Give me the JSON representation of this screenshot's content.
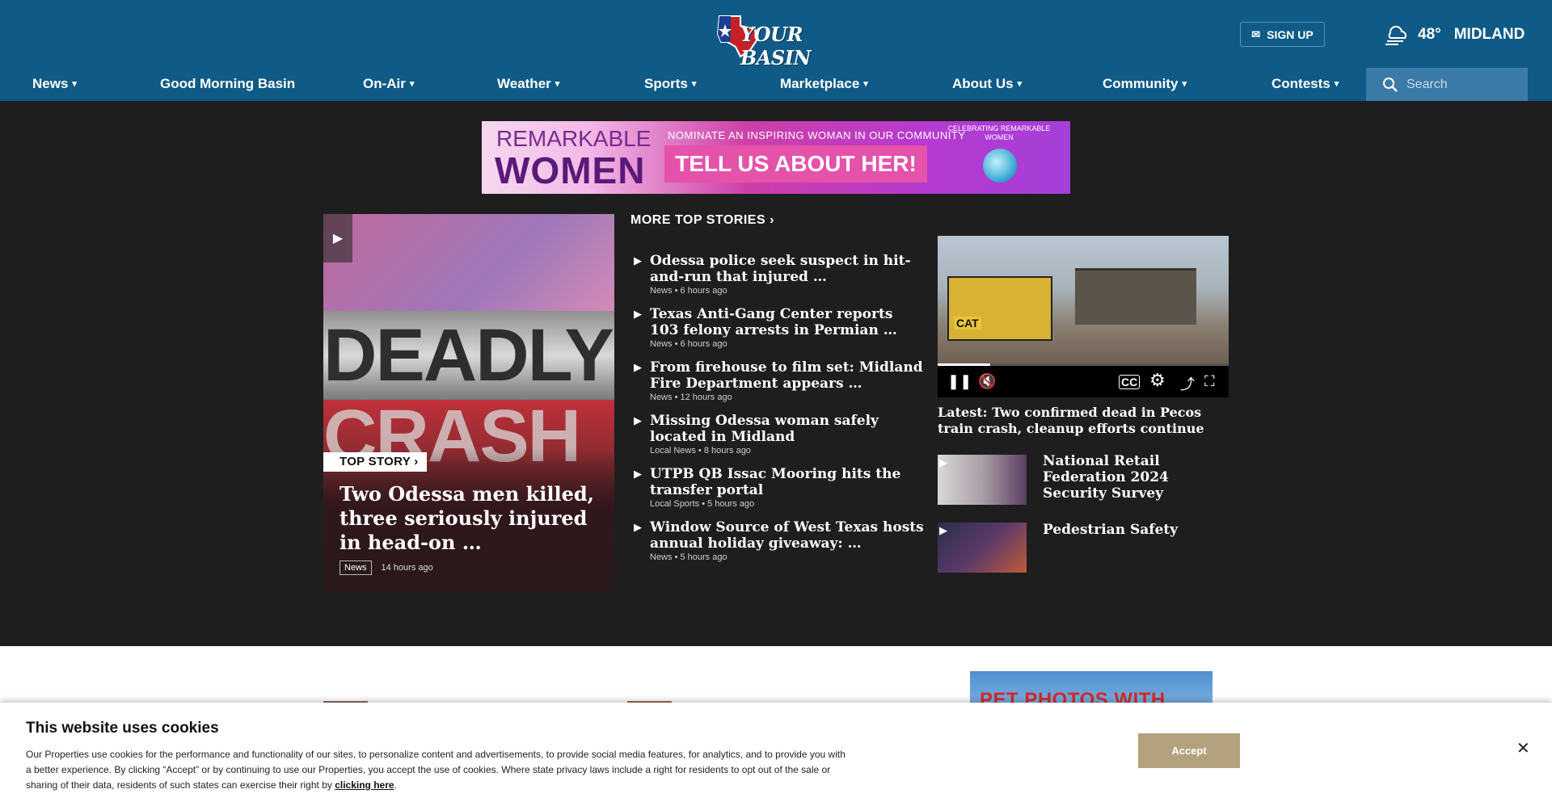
{
  "header": {
    "logo_text": "YOUR BASIN",
    "signup_label": "SIGN UP",
    "weather": {
      "temp": "48°",
      "city": "MIDLAND",
      "icon": "cloudy-windy-icon"
    },
    "search_placeholder": "Search"
  },
  "nav": {
    "items": [
      {
        "label": "News",
        "has_menu": true
      },
      {
        "label": "Good Morning Basin",
        "has_menu": false
      },
      {
        "label": "On-Air",
        "has_menu": true
      },
      {
        "label": "Weather",
        "has_menu": true
      },
      {
        "label": "Sports",
        "has_menu": true
      },
      {
        "label": "Marketplace",
        "has_menu": true
      },
      {
        "label": "About Us",
        "has_menu": true
      },
      {
        "label": "Community",
        "has_menu": true
      },
      {
        "label": "Contests",
        "has_menu": true
      }
    ],
    "caret_glyph": "▾"
  },
  "banner": {
    "line1": "REMARKABLE",
    "line2": "WOMEN",
    "nominate": "NOMINATE AN INSPIRING WOMAN IN OUR COMMUNITY",
    "cta": "TELL US  ABOUT HER!",
    "celebrating": "CELEBRATING REMARKABLE WOMEN"
  },
  "top_story": {
    "badge": "TOP STORY",
    "bg_word1": "DEADLY",
    "bg_word2": "CRASH",
    "title": "Two Odessa men killed, three seriously injured in head-on …",
    "category": "News",
    "time": "14 hours ago"
  },
  "more_top_stories": {
    "heading": "MORE TOP STORIES",
    "items": [
      {
        "title": "Odessa police seek suspect in hit-and-run that injured …",
        "category": "News",
        "time": "6 hours ago"
      },
      {
        "title": "Texas Anti-Gang Center reports 103 felony arrests in Permian …",
        "category": "News",
        "time": "6 hours ago"
      },
      {
        "title": "From firehouse to film set: Midland Fire Department appears …",
        "category": "News",
        "time": "12 hours ago"
      },
      {
        "title": "Missing Odessa woman safely located in Midland",
        "category": "Local News",
        "time": "8 hours ago"
      },
      {
        "title": "UTPB QB Issac Mooring hits the transfer portal",
        "category": "Local Sports",
        "time": "5 hours ago"
      },
      {
        "title": "Window Source of West Texas hosts annual holiday giveaway: …",
        "category": "News",
        "time": "5 hours ago"
      }
    ]
  },
  "video": {
    "caption": "Latest: Two confirmed dead in Pecos train crash, cleanup efforts continue",
    "progress": 0.18,
    "overlay_text": "CAT",
    "thumbs": [
      {
        "title": "National Retail Federation 2024 Security Survey"
      },
      {
        "title": "Pedestrian Safety"
      }
    ]
  },
  "lower": {
    "ad_text": "PET PHOTOS WITH SANTA!"
  },
  "cookie": {
    "title": "This website uses cookies",
    "body": "Our Properties use cookies for the performance and functionality of our sites, to personalize content and advertisements, to provide social media features, for analytics, and to provide you with a better experience. By clicking “Accept” or by continuing to use our Properties, you accept the use of cookies. Where state privacy laws include a right for residents to opt out of the sale or sharing of their data, residents of such states can exercise their right by ",
    "link": "clicking here",
    "accept_label": "Accept",
    "close_glyph": "✕"
  }
}
